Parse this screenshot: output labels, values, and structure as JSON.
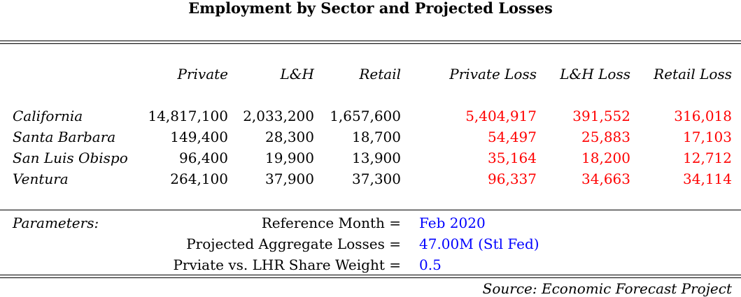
{
  "title": "Employment by Sector and Projected Losses",
  "table": {
    "headers": [
      "Private",
      "L&H",
      "Retail",
      "Private Loss",
      "L&H Loss",
      "Retail Loss"
    ],
    "rows": [
      {
        "region": "California",
        "values": [
          "14,817,100",
          "2,033,200",
          "1,657,600",
          "5,404,917",
          "391,552",
          "316,018"
        ]
      },
      {
        "region": "Santa Barbara",
        "values": [
          "149,400",
          "28,300",
          "18,700",
          "54,497",
          "25,883",
          "17,103"
        ]
      },
      {
        "region": "San Luis Obispo",
        "values": [
          "96,400",
          "19,900",
          "13,900",
          "35,164",
          "18,200",
          "12,712"
        ]
      },
      {
        "region": "Ventura",
        "values": [
          "264,100",
          "37,900",
          "37,300",
          "96,337",
          "34,663",
          "34,114"
        ]
      }
    ]
  },
  "parameters": {
    "label": "Parameters:",
    "items": [
      {
        "name": "Reference Month =",
        "value": "Feb 2020"
      },
      {
        "name": "Projected Aggregate Losses =",
        "value": "47.00M (Stl Fed)"
      },
      {
        "name": "Prviate vs. LHR Share Weight =",
        "value": "0.5"
      }
    ]
  },
  "source": "Source: Economic Forecast Project",
  "colors": {
    "loss": "#ff0000",
    "parameter_value": "#0000ff"
  }
}
